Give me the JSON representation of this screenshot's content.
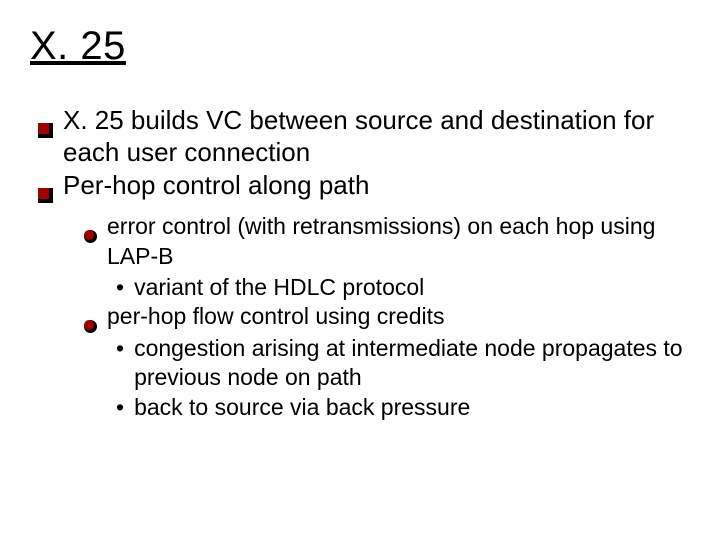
{
  "title": "X. 25",
  "bullets": [
    {
      "text": "X. 25 builds VC between source and destination for each user connection",
      "children": []
    },
    {
      "text": "Per-hop control along path",
      "children": [
        {
          "text": "error control (with retransmissions) on each hop using LAP-B",
          "children": [
            {
              "text": "variant of the HDLC protocol"
            }
          ]
        },
        {
          "text": "per-hop flow control using credits",
          "children": [
            {
              "text": "congestion arising at intermediate node propagates to previous node on path"
            },
            {
              "text": "back to source via  back pressure"
            }
          ]
        }
      ]
    }
  ]
}
